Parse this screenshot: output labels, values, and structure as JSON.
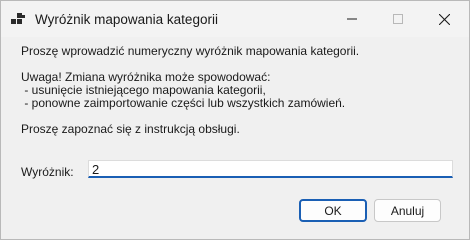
{
  "window": {
    "title": "Wyróżnik mapowania kategorii"
  },
  "controls": {
    "minimize_icon": "minimize-icon",
    "maximize_icon": "maximize-icon",
    "close_icon": "close-icon"
  },
  "message": {
    "prompt": "Proszę wprowadzić numeryczny wyróżnik mapowania kategorii.",
    "warning_heading": "Uwaga! Zmiana wyróżnika może spowodować:",
    "warning_item_1": " - usunięcie istniejącego mapowania kategorii,",
    "warning_item_2": " - ponowne zaimportowanie części lub wszystkich zamówień.",
    "manual_note": "Proszę zapoznać się z instrukcją obsługi."
  },
  "form": {
    "label": "Wyróżnik:",
    "value": "2"
  },
  "buttons": {
    "ok": "OK",
    "cancel": "Anuluj"
  },
  "colors": {
    "accent": "#1a5fb4"
  }
}
